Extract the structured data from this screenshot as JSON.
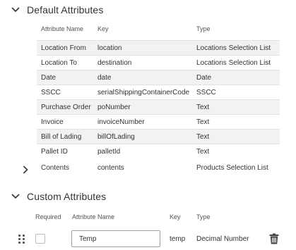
{
  "default_section": {
    "title": "Default Attributes",
    "headers": {
      "name": "Attribute Name",
      "key": "Key",
      "type": "Type"
    },
    "rows": [
      {
        "name": "Location From",
        "key": "location",
        "type": "Locations Selection List"
      },
      {
        "name": "Location To",
        "key": "destination",
        "type": "Locations Selection List"
      },
      {
        "name": "Date",
        "key": "date",
        "type": "Date"
      },
      {
        "name": "SSCC",
        "key": "serialShippingContainerCode",
        "type": "SSCC"
      },
      {
        "name": "Purchase Order",
        "key": "poNumber",
        "type": "Text"
      },
      {
        "name": "Invoice",
        "key": "invoiceNumber",
        "type": "Text"
      },
      {
        "name": "Bill of Lading",
        "key": "billOfLading",
        "type": "Text"
      },
      {
        "name": "Pallet ID",
        "key": "palletId",
        "type": "Text"
      },
      {
        "name": "Contents",
        "key": "contents",
        "type": "Products Selection List"
      }
    ]
  },
  "custom_section": {
    "title": "Custom Attributes",
    "headers": {
      "required": "Required",
      "name": "Attribute Name",
      "key": "Key",
      "type": "Type"
    },
    "row": {
      "name_value": "Temp",
      "key": "temp",
      "type": "Decimal Number",
      "required": false
    }
  },
  "icons": {
    "collapse": "chevron-down-icon",
    "expand": "chevron-right-icon",
    "drag": "drag-handle-icon",
    "delete": "trash-icon"
  }
}
